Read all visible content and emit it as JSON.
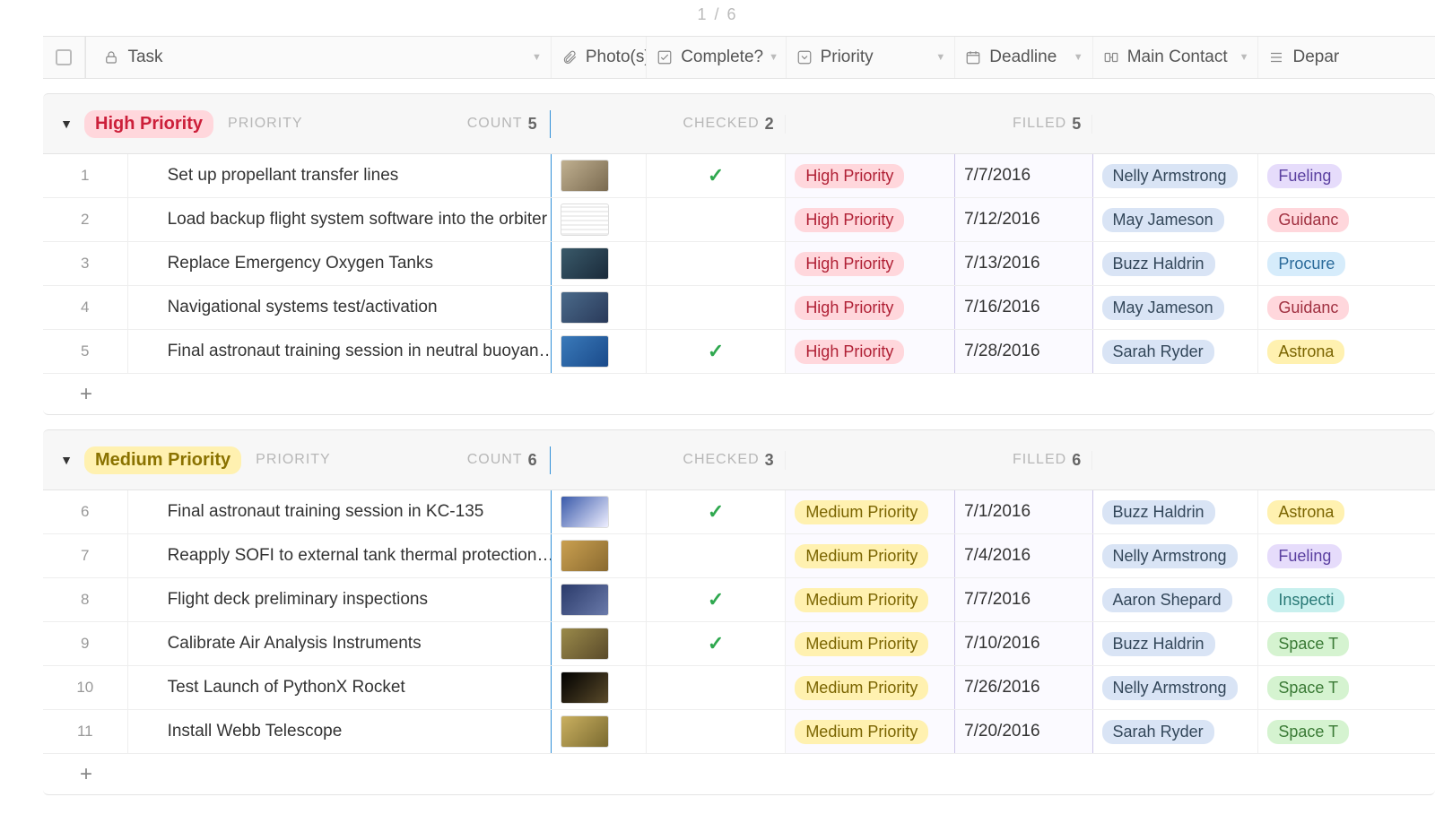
{
  "page_indicator": "1 / 6",
  "header": {
    "task": "Task",
    "photo": "Photo(s)",
    "complete": "Complete?",
    "priority": "Priority",
    "deadline": "Deadline",
    "contact": "Main Contact",
    "department": "Depar"
  },
  "groups": [
    {
      "name": "High Priority",
      "chip_class": "high",
      "sub_label": "PRIORITY",
      "count_label": "COUNT",
      "count": "5",
      "checked_label": "CHECKED",
      "checked": "2",
      "filled_label": "FILLED",
      "filled": "5",
      "rows": [
        {
          "num": "1",
          "task": "Set up propellant transfer lines",
          "thumb": "t-a",
          "complete": true,
          "priority": "High Priority",
          "pri_class": "pri-high",
          "deadline": "7/7/2016",
          "contact": "Nelly Armstrong",
          "dept": "Fueling",
          "dept_class": "dept-fuel"
        },
        {
          "num": "2",
          "task": "Load backup flight system software into the orbiter",
          "thumb": "t-b",
          "complete": false,
          "priority": "High Priority",
          "pri_class": "pri-high",
          "deadline": "7/12/2016",
          "contact": "May Jameson",
          "dept": "Guidanc",
          "dept_class": "dept-guid"
        },
        {
          "num": "3",
          "task": "Replace Emergency Oxygen Tanks",
          "thumb": "t-c",
          "complete": false,
          "priority": "High Priority",
          "pri_class": "pri-high",
          "deadline": "7/13/2016",
          "contact": "Buzz Haldrin",
          "dept": "Procure",
          "dept_class": "dept-proc"
        },
        {
          "num": "4",
          "task": "Navigational systems test/activation",
          "thumb": "t-d",
          "complete": false,
          "priority": "High Priority",
          "pri_class": "pri-high",
          "deadline": "7/16/2016",
          "contact": "May Jameson",
          "dept": "Guidanc",
          "dept_class": "dept-guid"
        },
        {
          "num": "5",
          "task": "Final astronaut training session in neutral buoyan…",
          "thumb": "t-e",
          "complete": true,
          "priority": "High Priority",
          "pri_class": "pri-high",
          "deadline": "7/28/2016",
          "contact": "Sarah Ryder",
          "dept": "Astrona",
          "dept_class": "dept-astro"
        }
      ]
    },
    {
      "name": "Medium Priority",
      "chip_class": "medium",
      "sub_label": "PRIORITY",
      "count_label": "COUNT",
      "count": "6",
      "checked_label": "CHECKED",
      "checked": "3",
      "filled_label": "FILLED",
      "filled": "6",
      "rows": [
        {
          "num": "6",
          "task": "Final astronaut training session in KC-135",
          "thumb": "t-f",
          "complete": true,
          "priority": "Medium Priority",
          "pri_class": "pri-med",
          "deadline": "7/1/2016",
          "contact": "Buzz Haldrin",
          "dept": "Astrona",
          "dept_class": "dept-astro"
        },
        {
          "num": "7",
          "task": "Reapply SOFI to external tank thermal protection…",
          "thumb": "t-g",
          "complete": false,
          "priority": "Medium Priority",
          "pri_class": "pri-med",
          "deadline": "7/4/2016",
          "contact": "Nelly Armstrong",
          "dept": "Fueling",
          "dept_class": "dept-fuel"
        },
        {
          "num": "8",
          "task": "Flight deck preliminary inspections",
          "thumb": "t-h",
          "complete": true,
          "priority": "Medium Priority",
          "pri_class": "pri-med",
          "deadline": "7/7/2016",
          "contact": "Aaron Shepard",
          "dept": "Inspecti",
          "dept_class": "dept-insp"
        },
        {
          "num": "9",
          "task": "Calibrate Air Analysis Instruments",
          "thumb": "t-i",
          "complete": true,
          "priority": "Medium Priority",
          "pri_class": "pri-med",
          "deadline": "7/10/2016",
          "contact": "Buzz Haldrin",
          "dept": "Space T",
          "dept_class": "dept-space"
        },
        {
          "num": "10",
          "task": "Test Launch of PythonX Rocket",
          "thumb": "t-j",
          "complete": false,
          "priority": "Medium Priority",
          "pri_class": "pri-med",
          "deadline": "7/26/2016",
          "contact": "Nelly Armstrong",
          "dept": "Space T",
          "dept_class": "dept-space"
        },
        {
          "num": "11",
          "task": "Install Webb Telescope",
          "thumb": "t-k",
          "complete": false,
          "priority": "Medium Priority",
          "pri_class": "pri-med",
          "deadline": "7/20/2016",
          "contact": "Sarah Ryder",
          "dept": "Space T",
          "dept_class": "dept-space"
        }
      ]
    }
  ]
}
